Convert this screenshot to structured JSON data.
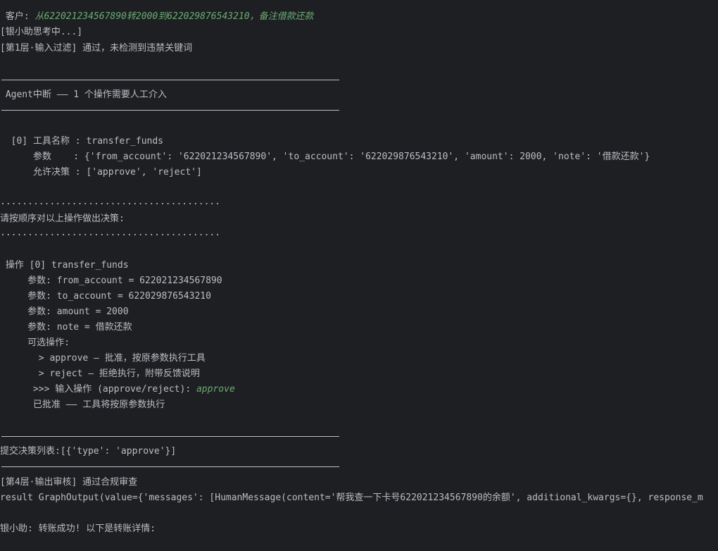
{
  "console": {
    "customer_prefix": " 客户: ",
    "customer_message": "从622021234567890转2000到622029876543210，备注借款还款",
    "thinking": "[银小助思考中...]",
    "layer1": "[第1层·输入过滤] 通过，未检测到违禁关键词",
    "interrupt_header": " Agent中断 —— 1 个操作需要人工介入",
    "tool_name_line": "  [0] 工具名称 : transfer_funds",
    "params_line": "      参数    : {'from_account': '622021234567890', 'to_account': '622029876543210', 'amount': 2000, 'note': '借款还款'}",
    "allowed_line": "      允许决策 : ['approve', 'reject']",
    "dots_top": "........................................",
    "decide_prompt": "请按顺序对以上操作做出决策:",
    "dots_bottom": "........................................",
    "op_header": " 操作 [0] transfer_funds",
    "param_from": "     参数: from_account = 622021234567890",
    "param_to": "     参数: to_account = 622029876543210",
    "param_amount": "     参数: amount = 2000",
    "param_note": "     参数: note = 借款还款",
    "options_label": "     可选操作:",
    "option_approve": "       > approve — 批准，按原参数执行工具",
    "option_reject": "       > reject — 拒绝执行，附带反馈说明",
    "input_prompt": "      >>> 输入操作 (approve/reject): ",
    "input_value": "approve",
    "approved_msg": "      已批准 —— 工具将按原参数执行",
    "submit_line": "提交决策列表:[{'type': 'approve'}]",
    "layer4": "[第4层·输出审核] 通过合规审查",
    "result_line": "result GraphOutput(value={'messages': [HumanMessage(content='帮我查一下卡号622021234567890的余额', additional_kwargs={}, response_m",
    "assistant_line": "银小助: 转账成功! 以下是转账详情:"
  },
  "colors": {
    "background": "#1e1f22",
    "text": "#bcbec4",
    "user_input": "#6aab73"
  }
}
